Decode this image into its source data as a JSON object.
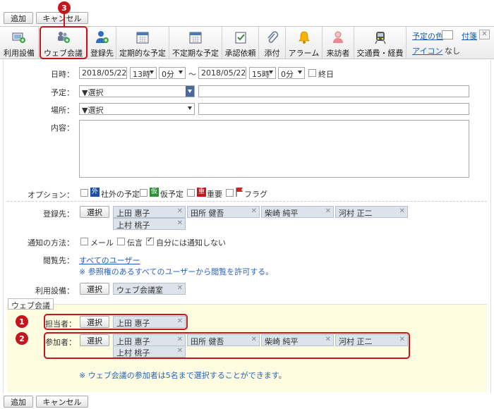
{
  "top_buttons": {
    "add": "追加",
    "cancel": "キャンセル"
  },
  "toolbar": {
    "items": [
      {
        "label": "利用設備"
      },
      {
        "label": "ウェブ会議"
      },
      {
        "label": "登録先"
      },
      {
        "label": "定期的な予定"
      },
      {
        "label": "不定期な予定"
      },
      {
        "label": "承認依頼"
      },
      {
        "label": "添付"
      },
      {
        "label": "アラーム"
      },
      {
        "label": "来訪者"
      },
      {
        "label": "交通費・経費"
      }
    ],
    "schedule_color_link": "予定の色",
    "icon_link": "アイコン",
    "icon_value": "なし",
    "sticky_link": "付箋"
  },
  "form": {
    "datetime_label": "日時：",
    "start_date": "2018/05/22",
    "start_hour": "13時",
    "start_min": "0分",
    "tilde": "～",
    "end_date": "2018/05/22",
    "end_hour": "15時",
    "end_min": "0分",
    "allday": "終日",
    "schedule_label": "予定：",
    "schedule_select": "▼選択",
    "place_label": "場所：",
    "place_select": "▼選択",
    "content_label": "内容：",
    "option_label": "オプション：",
    "options": [
      {
        "badge": "外",
        "label": "社外の予定",
        "color": "#1d4fa0"
      },
      {
        "badge": "仮",
        "label": "仮予定",
        "color": "#2f8f3a"
      },
      {
        "badge": "重",
        "label": "重要",
        "color": "#c4161c"
      },
      {
        "badge": "",
        "label": "フラグ",
        "color": "#d42020"
      }
    ],
    "registered_label": "登録先：",
    "select_btn": "選択",
    "registered_users": [
      "上田 惠子",
      "田所 健吾",
      "柴崎 純平",
      "河村 正二",
      "上村 桃子"
    ],
    "notify_label": "通知の方法：",
    "notify_options": [
      {
        "label": "メール",
        "checked": false
      },
      {
        "label": "伝言",
        "checked": false
      },
      {
        "label": "自分には通知しない",
        "checked": true
      }
    ],
    "viewer_label": "閲覧先：",
    "viewer_link": "すべてのユーザー",
    "viewer_note": "※ 参照権のあるすべてのユーザーから閲覧を許可する。",
    "facility_label": "利用設備：",
    "facility_value": "ウェブ会議室"
  },
  "web_meeting": {
    "section_label": "ウェブ会議",
    "host_label": "担当者：",
    "host_value": "上田 惠子",
    "participant_label": "参加者：",
    "participants": [
      "上田 惠子",
      "田所 健吾",
      "柴崎 純平",
      "河村 正二",
      "上村 桃子"
    ],
    "note": "※ ウェブ会議の参加者は5名まで選択することができます。"
  },
  "callouts": {
    "one": "1",
    "two": "2",
    "three": "3"
  },
  "colors": {
    "accent_red": "#c4161c",
    "web_bg": "#fdfbe0",
    "chip_bg": "#dde3ea",
    "link": "#1a5fb4"
  }
}
